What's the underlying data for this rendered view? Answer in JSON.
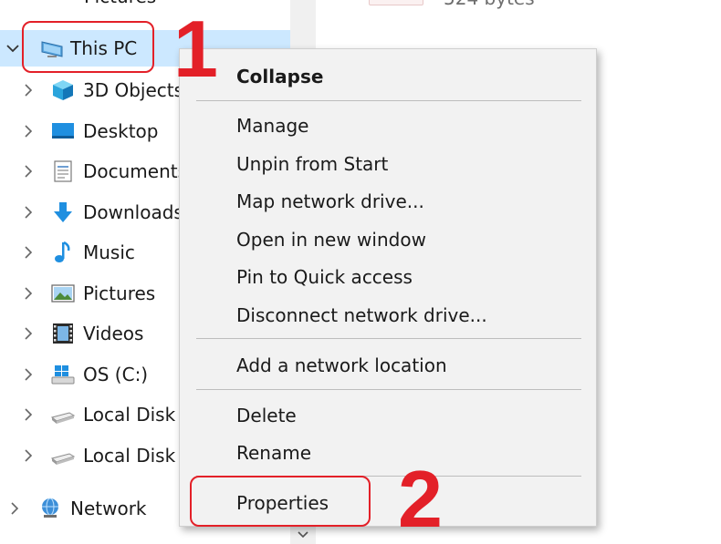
{
  "nav": {
    "top_partial_label": "Pictures",
    "items": [
      {
        "label": "This PC",
        "icon": "computer-icon"
      },
      {
        "label": "3D Objects",
        "icon": "cube-icon"
      },
      {
        "label": "Desktop",
        "icon": "desktop-icon"
      },
      {
        "label": "Documents",
        "icon": "document-icon"
      },
      {
        "label": "Downloads",
        "icon": "download-arrow-icon"
      },
      {
        "label": "Music",
        "icon": "music-note-icon"
      },
      {
        "label": "Pictures",
        "icon": "picture-icon"
      },
      {
        "label": "Videos",
        "icon": "film-icon"
      },
      {
        "label": "OS (C:)",
        "icon": "windows-drive-icon"
      },
      {
        "label": "Local Disk",
        "icon": "disk-drive-icon"
      },
      {
        "label": "Local Disk",
        "icon": "disk-drive-icon"
      },
      {
        "label": "Network",
        "icon": "network-globe-icon"
      }
    ]
  },
  "content": {
    "file_size": "524 bytes"
  },
  "context_menu": {
    "items": {
      "collapse": "Collapse",
      "manage": "Manage",
      "unpin_from_start": "Unpin from Start",
      "map_network_drive": "Map network drive...",
      "open_in_new_window": "Open in new window",
      "pin_to_quick_access": "Pin to Quick access",
      "disconnect_network_drive": "Disconnect network drive...",
      "add_network_location": "Add a network location",
      "delete": "Delete",
      "rename": "Rename",
      "properties": "Properties"
    }
  },
  "annotations": {
    "step1": "1",
    "step2": "2",
    "color": "#e32028"
  },
  "colors": {
    "selection": "#cce8ff",
    "menu_bg": "#f2f2f2",
    "accent_blue": "#1f8fe0"
  }
}
